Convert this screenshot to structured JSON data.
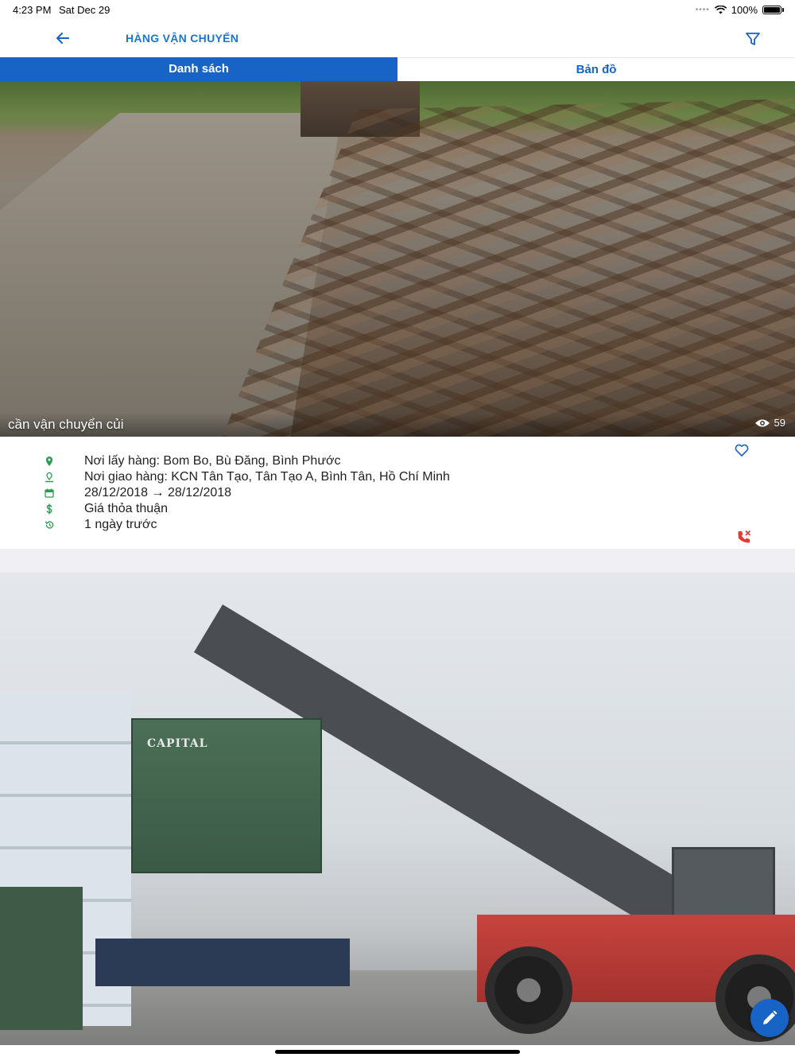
{
  "status_bar": {
    "time": "4:23 PM",
    "date": "Sat Dec 29",
    "battery": "100%"
  },
  "header": {
    "title": "HÀNG VẬN CHUYỂN",
    "back_icon": "arrow-left-icon",
    "filter_icon": "filter-icon"
  },
  "tabs": [
    {
      "label": "Danh sách",
      "active": true
    },
    {
      "label": "Bản đồ",
      "active": false
    }
  ],
  "listings": [
    {
      "title": "cần vận chuyển củi",
      "views": "59",
      "pickup": "Nơi lấy hàng: Bom Bo, Bù Đăng, Bình Phước",
      "delivery": "Nơi giao hàng: KCN Tân Tạo, Tân Tạo A, Bình Tân, Hồ Chí Minh",
      "dates": "28/12/2018 → 28/12/2018",
      "price": "Giá thỏa thuận",
      "posted": "1 ngày trước"
    },
    {
      "container_label": "CAPITAL"
    }
  ],
  "colors": {
    "brand": "#1763c6",
    "detail_icon": "#2e9b52",
    "phone": "#e53935"
  }
}
